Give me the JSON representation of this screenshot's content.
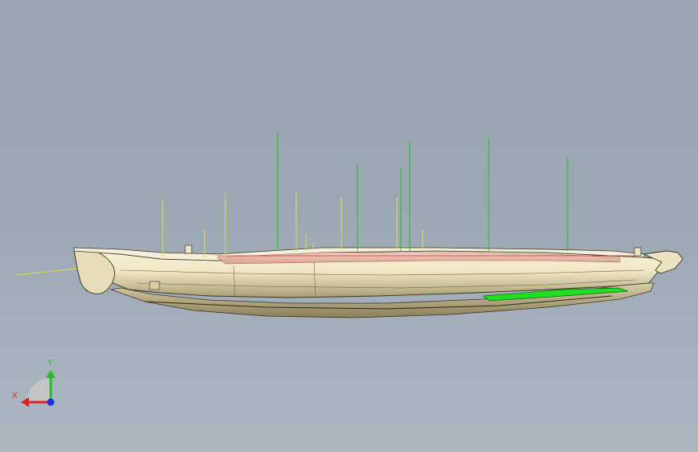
{
  "viewport": {
    "background_top": "#9aa6b2",
    "background_bottom": "#acb6c1"
  },
  "model": {
    "body_color": "#efe6c4",
    "shadow_color": "#b8ac84",
    "edge_color": "#3a3424",
    "inner_color": "#e8b9a8",
    "highlight_green": "#22dd22",
    "green_line_color": "#22c022",
    "yellow_line_color": "#e0e040"
  },
  "triad": {
    "x_label": "X",
    "y_label": "Y",
    "x_color": "#e02020",
    "y_color": "#20c020",
    "z_color": "#2030e0",
    "plane_color": "#c8c8c8"
  }
}
